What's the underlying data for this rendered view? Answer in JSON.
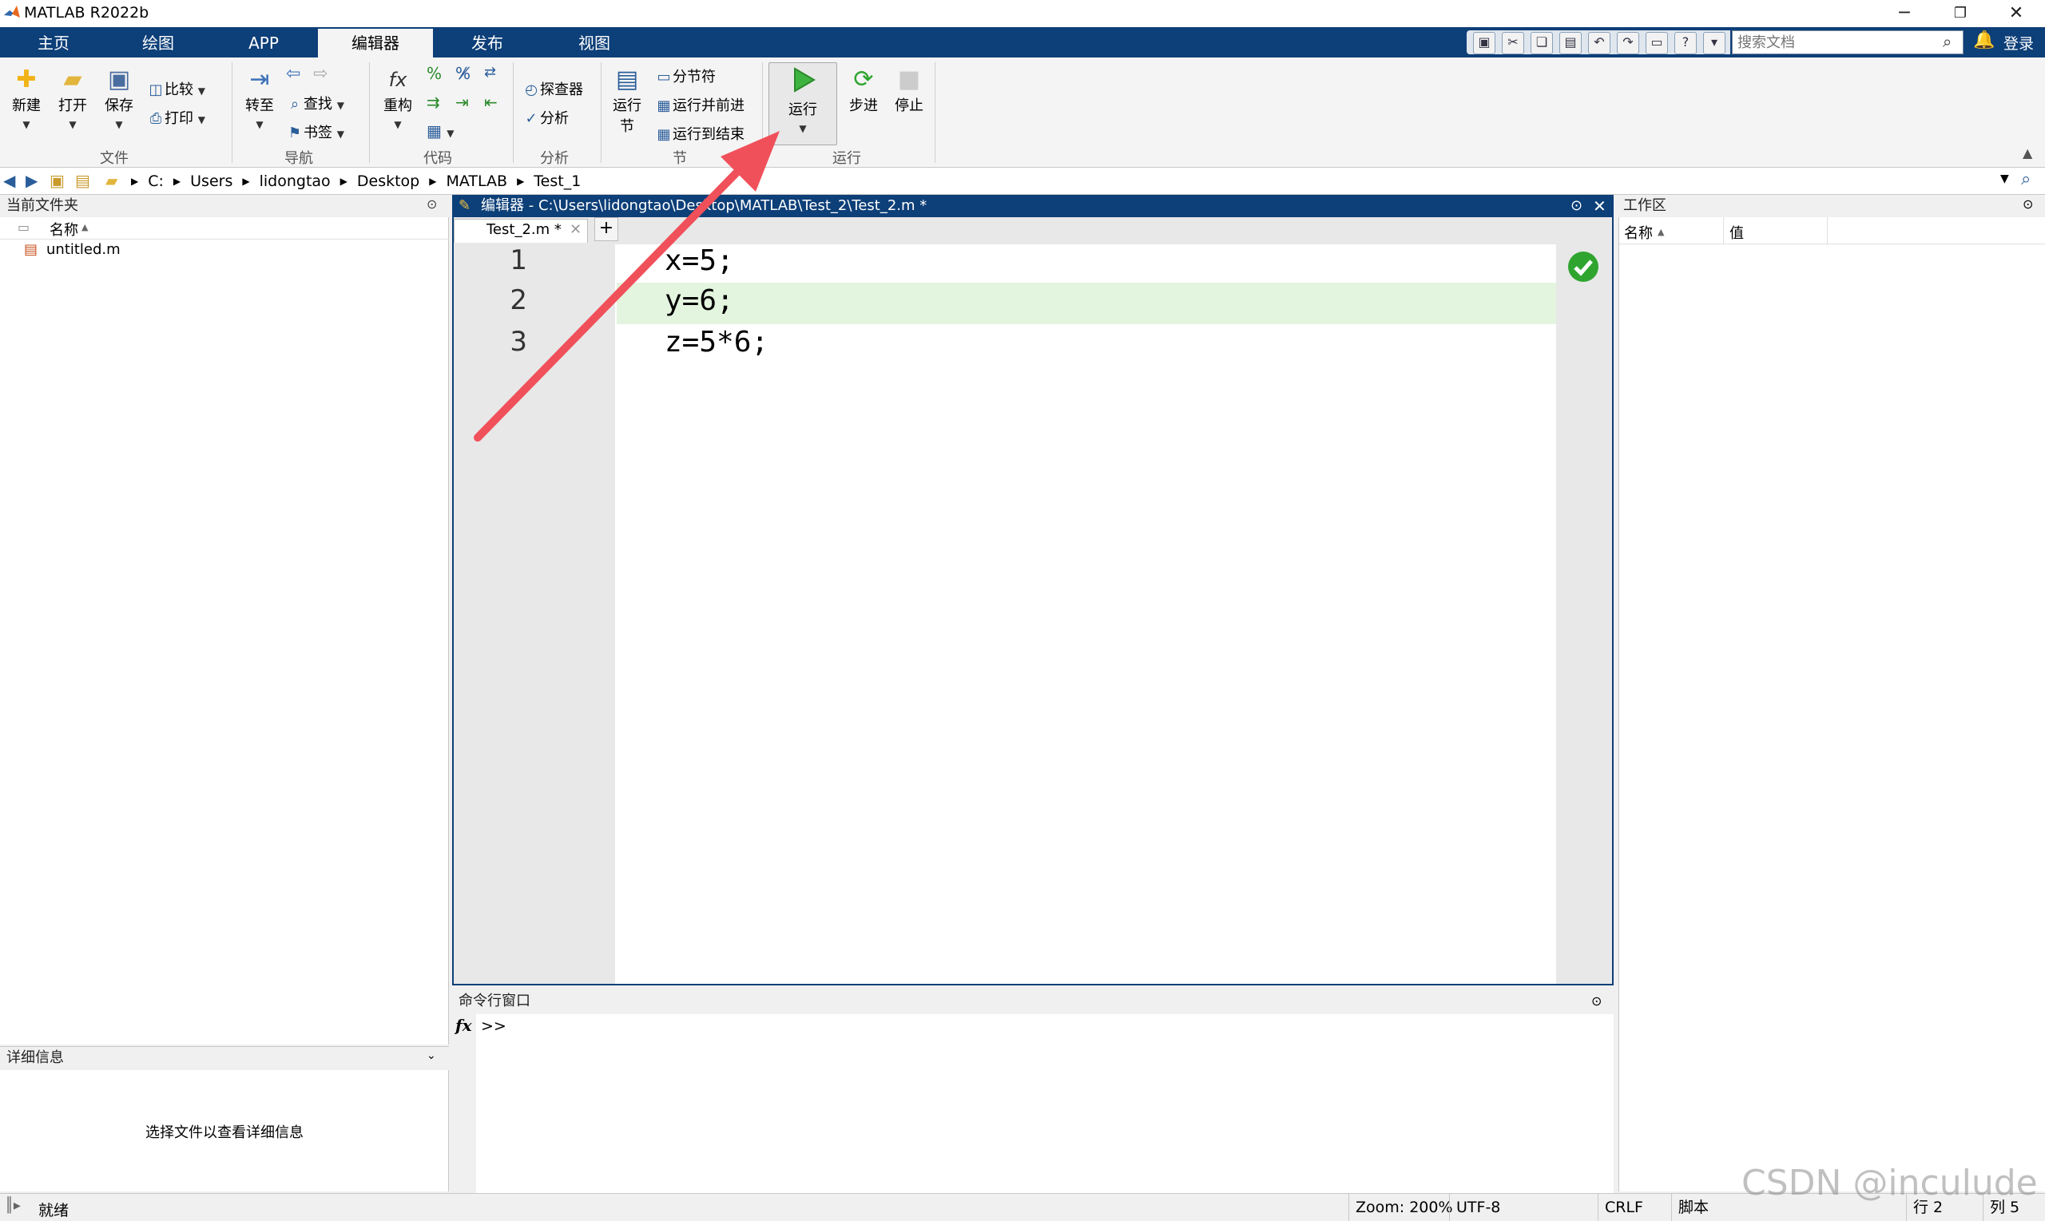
{
  "window": {
    "title": "MATLAB R2022b"
  },
  "tabs": [
    "主页",
    "绘图",
    "APP",
    "编辑器",
    "发布",
    "视图"
  ],
  "search": {
    "placeholder": "搜索文档"
  },
  "login": "登录",
  "ribbon": {
    "file": {
      "new": "新建",
      "open": "打开",
      "save": "保存",
      "compare": "比较",
      "print": "打印",
      "group": "文件"
    },
    "nav": {
      "goto": "转至",
      "find": "查找",
      "bookmark": "书签",
      "group": "导航"
    },
    "code": {
      "refactor": "重构",
      "group": "代码"
    },
    "analyze": {
      "profiler": "探查器",
      "analyze": "分析",
      "group": "分析"
    },
    "section": {
      "run_section": "运行节",
      "section_break": "分节符",
      "run_advance": "运行并前进",
      "run_to_end": "运行到结束",
      "group": "节"
    },
    "run": {
      "run": "运行",
      "step": "步进",
      "stop": "停止",
      "group": "运行"
    }
  },
  "address": {
    "parts": [
      "C:",
      "Users",
      "lidongtao",
      "Desktop",
      "MATLAB",
      "Test_1"
    ]
  },
  "current_folder": {
    "title": "当前文件夹",
    "column": "名称",
    "files": [
      "untitled.m"
    ]
  },
  "details": {
    "title": "详细信息",
    "message": "选择文件以查看详细信息"
  },
  "editor": {
    "title": "编辑器 - C:\\Users\\lidongtao\\Desktop\\MATLAB\\Test_2\\Test_2.m *",
    "tab": "Test_2.m *",
    "lines": [
      {
        "num": "1",
        "text": "x=5;"
      },
      {
        "num": "2",
        "text": "y=6;"
      },
      {
        "num": "3",
        "text": "z=5*6;"
      }
    ]
  },
  "command": {
    "title": "命令行窗口",
    "fx": "fx",
    "prompt": ">>"
  },
  "workspace": {
    "title": "工作区",
    "col_name": "名称",
    "col_value": "值"
  },
  "status": {
    "ready": "就绪",
    "zoom": "Zoom: 200%",
    "encoding": "UTF-8",
    "eol": "CRLF",
    "type": "脚本",
    "row": "行 2",
    "col": "列 5"
  },
  "watermark": "CSDN @inculude",
  "colors": {
    "accent": "#0d3f78",
    "highlight_line": "#e4f5df",
    "run_green": "#2fa52f",
    "arrow": "#f0505a"
  }
}
